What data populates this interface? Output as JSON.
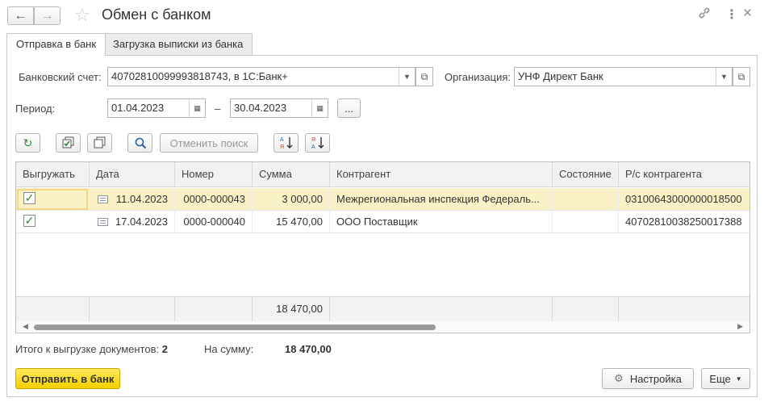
{
  "window": {
    "title": "Обмен с банком",
    "back_icon": "arrow-left-icon",
    "forward_icon": "arrow-right-icon",
    "star_icon": "star-icon",
    "link_icon": "link-icon",
    "more_icon": "more-vertical-icon",
    "close_glyph": "×"
  },
  "tabs": [
    {
      "label": "Отправка в банк",
      "active": true
    },
    {
      "label": "Загрузка выписки из банка",
      "active": false
    }
  ],
  "form": {
    "account_label": "Банковский счет:",
    "account_value": "40702810099993818743, в 1С:Банк+",
    "org_label": "Организация:",
    "org_value": "УНФ Директ Банк",
    "period_label": "Период:",
    "period_from": "01.04.2023",
    "period_dash": "–",
    "period_to": "30.04.2023",
    "period_more": "..."
  },
  "toolbar": {
    "cancel_search_label": "Отменить поиск"
  },
  "table": {
    "columns": [
      "Выгружать",
      "Дата",
      "Номер",
      "Сумма",
      "Контрагент",
      "Состояние",
      "Р/с контрагента"
    ],
    "rows": [
      {
        "checked": true,
        "date": "11.04.2023",
        "number": "0000-000043",
        "sum": "3 000,00",
        "counterparty": "Межрегиональная инспекция Федераль...",
        "state": "",
        "account": "03100643000000018500"
      },
      {
        "checked": true,
        "date": "17.04.2023",
        "number": "0000-000040",
        "sum": "15 470,00",
        "counterparty": "ООО Поставщик",
        "state": "",
        "account": "40702810038250017388"
      }
    ],
    "total_sum": "18 470,00"
  },
  "summary": {
    "docs_label": "Итого к выгрузке документов:",
    "docs_count": "2",
    "sum_label": "На сумму:",
    "sum_value": "18 470,00"
  },
  "buttons": {
    "send_label": "Отправить в банк",
    "settings_label": "Настройка",
    "more_label": "Еще"
  }
}
